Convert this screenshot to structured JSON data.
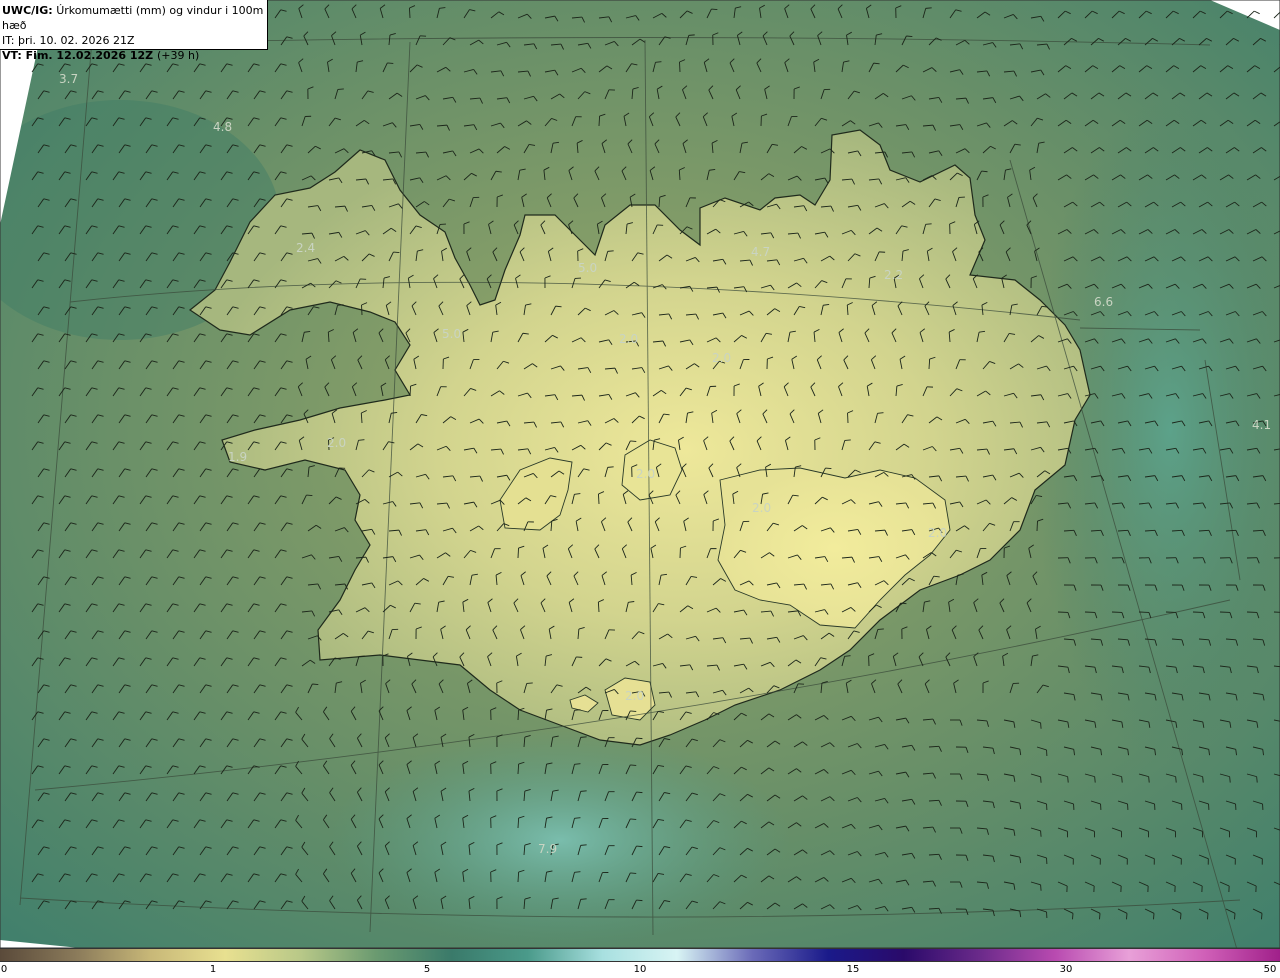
{
  "header": {
    "model": "UWC/IG:",
    "title": "Úrkomumætti (mm) og vindur i 100m hæð",
    "initial_time": "IT: þri. 10. 02. 2026 21Z",
    "valid_prefix": "VT:",
    "valid_time_bold": "Fim. 12.02.2026 12Z",
    "valid_offset": "(+39 h)"
  },
  "value_labels": [
    {
      "text": "3.7"
    },
    {
      "text": "4.8"
    },
    {
      "text": "2.4"
    },
    {
      "text": "5.0"
    },
    {
      "text": "5.0"
    },
    {
      "text": "2.0"
    },
    {
      "text": "2.0"
    },
    {
      "text": "4.7"
    },
    {
      "text": "2.2"
    },
    {
      "text": "6.6"
    },
    {
      "text": "4.1"
    },
    {
      "text": "2.0"
    },
    {
      "text": "2.0"
    },
    {
      "text": "2.0"
    },
    {
      "text": "2.0"
    },
    {
      "text": "1.9"
    },
    {
      "text": "2.0"
    },
    {
      "text": "7.9"
    }
  ],
  "colorbar": {
    "ticks": [
      "0",
      "1",
      "5",
      "10",
      "15",
      "30",
      "50"
    ],
    "colors": [
      "#5a4a3a",
      "#8a7a5a",
      "#c8b878",
      "#e8e090",
      "#b8c888",
      "#6a9a70",
      "#3a7a6a",
      "#4a9a8a",
      "#a8e0e0",
      "#d8f4f4",
      "#6a6ab8",
      "#1a1a8a",
      "#2a0a6a",
      "#6a2a8a",
      "#b84ab0",
      "#e8a0d8",
      "#d060b8",
      "#a0208a"
    ]
  }
}
